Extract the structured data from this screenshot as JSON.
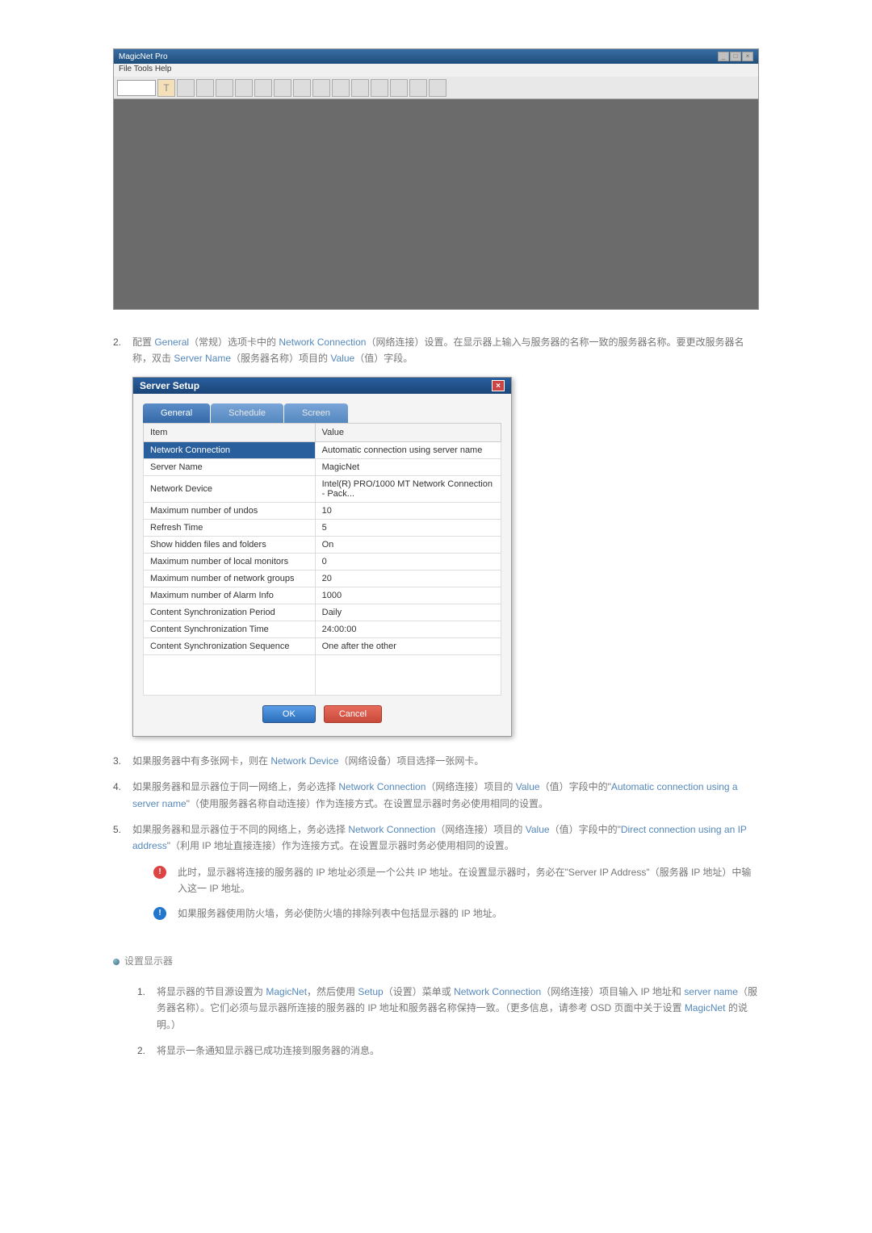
{
  "app_window": {
    "title": "MagicNet Pro",
    "menu": "File  Tools  Help",
    "toolbar_text": "T"
  },
  "steps": {
    "s2": {
      "num": "2.",
      "text_p1": "配置 ",
      "hl1": "General",
      "text_p2": "（常规）选项卡中的 ",
      "hl2": "Network Connection",
      "text_p3": "（网络连接）设置。在显示器上输入与服务器的名称一致的服务器名称。要更改服务器名称，双击 ",
      "hl3": "Server Name",
      "text_p4": "（服务器名称）项目的 ",
      "hl4": "Value",
      "text_p5": "（值）字段。"
    },
    "s3": {
      "num": "3.",
      "text_p1": "如果服务器中有多张网卡，则在 ",
      "hl1": "Network Device",
      "text_p2": "（网络设备）项目选择一张网卡。"
    },
    "s4": {
      "num": "4.",
      "text_p1": "如果服务器和显示器位于同一网络上，务必选择 ",
      "hl1": "Network Connection",
      "text_p2": "（网络连接）项目的 ",
      "hl2": "Value",
      "text_p3": "（值）字段中的\"",
      "hl3": "Automatic connection using a server name",
      "text_p4": "\"（使用服务器名称自动连接）作为连接方式。在设置显示器时务必使用相同的设置。"
    },
    "s5": {
      "num": "5.",
      "text_p1": "如果服务器和显示器位于不同的网络上，务必选择 ",
      "hl1": "Network Connection",
      "text_p2": "（网络连接）项目的 ",
      "hl2": "Value",
      "text_p3": "（值）字段中的\"",
      "hl3": "Direct connection using an IP address",
      "text_p4": "\"（利用 IP 地址直接连接）作为连接方式。在设置显示器时务必使用相同的设置。"
    }
  },
  "setup": {
    "title": "Server Setup",
    "tabs": {
      "general": "General",
      "schedule": "Schedule",
      "screen": "Screen"
    },
    "header_item": "Item",
    "header_value": "Value",
    "rows": [
      {
        "item": "Network Connection",
        "value": "Automatic connection using server name",
        "selected": true
      },
      {
        "item": "Server Name",
        "value": "MagicNet"
      },
      {
        "item": "Network Device",
        "value": "Intel(R) PRO/1000 MT Network Connection - Pack..."
      },
      {
        "item": "Maximum number of undos",
        "value": "10"
      },
      {
        "item": "Refresh Time",
        "value": "5"
      },
      {
        "item": "Show hidden files and folders",
        "value": "On"
      },
      {
        "item": "Maximum number of local monitors",
        "value": "0"
      },
      {
        "item": "Maximum number of network groups",
        "value": "20"
      },
      {
        "item": "Maximum number of Alarm Info",
        "value": "1000"
      },
      {
        "item": "Content Synchronization Period",
        "value": "Daily"
      },
      {
        "item": "Content Synchronization Time",
        "value": "24:00:00"
      },
      {
        "item": "Content Synchronization Sequence",
        "value": "One after the other"
      }
    ],
    "ok": "OK",
    "cancel": "Cancel"
  },
  "notes": {
    "n1_p1": "此时，显示器将连接的服务器的 IP 地址必须是一个公共 IP 地址。在设置显示器时，务必在\"",
    "n1_hl": "Server IP Address",
    "n1_p2": "\"（服务器 IP 地址）中输入这一 IP 地址。",
    "n2": "如果服务器使用防火墙，务必使防火墙的排除列表中包括显示器的 IP 地址。"
  },
  "monitor_section": {
    "title": "设置显示器",
    "s1": {
      "num": "1.",
      "text_p1": "将显示器的节目源设置为 ",
      "hl1": "MagicNet",
      "text_p2": "，然后使用 ",
      "hl2": "Setup",
      "text_p3": "（设置）菜单或 ",
      "hl3": "Network Connection",
      "text_p4": "（网络连接）项目输入 IP 地址和 ",
      "hl4": "server name",
      "text_p5": "（服务器名称）。它们必须与显示器所连接的服务器的 IP 地址和服务器名称保持一致。（更多信息，请参考 OSD 页面中关于设置 ",
      "hl5": "MagicNet",
      "text_p6": " 的说明。）"
    },
    "s2": {
      "num": "2.",
      "text": "将显示一条通知显示器已成功连接到服务器的消息。"
    }
  }
}
